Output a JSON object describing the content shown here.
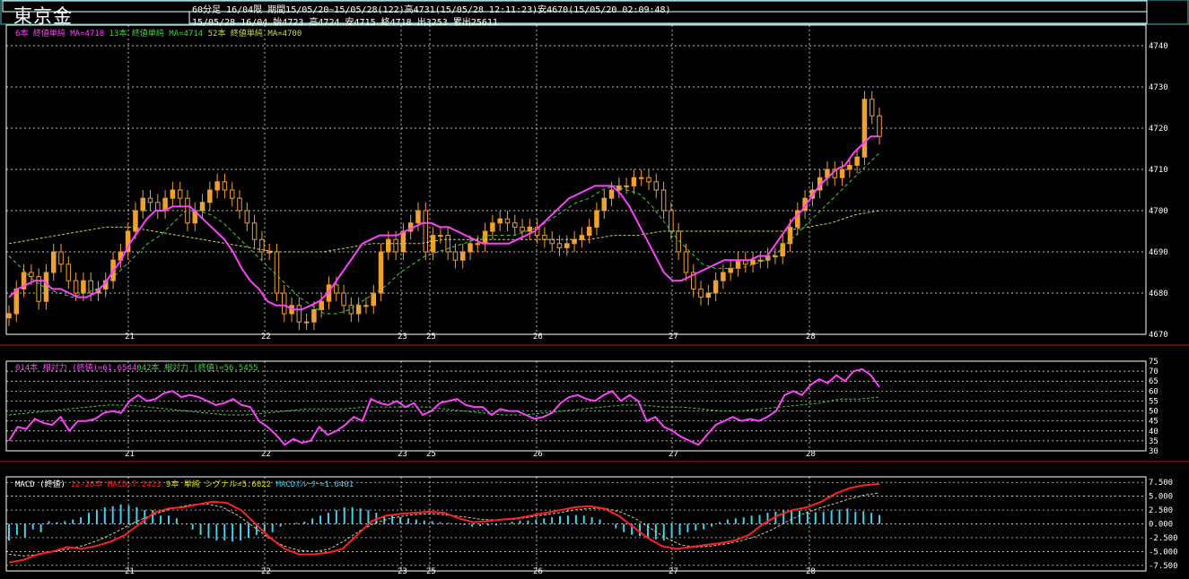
{
  "header": {
    "title": "東京金",
    "line1": "60分足 16/04限 期間15/05/20~15/05/28(122)高4731(15/05/28 12:11:23)安4670(15/05/20 02:09:48)",
    "line2": "15/05/28 16/04 始4723 高4724 安4715 終4718 出3253 累出25611"
  },
  "colors": {
    "ma_short": "#ff40ff",
    "ma_mid": "#40d040",
    "ma_long": "#c8d850",
    "candle_up": "#f0a030",
    "rsi_line": "#ff40ff",
    "macd_line": "#ff2020",
    "signal_line": "#d0d0a0",
    "osc_bar": "#40d0f0",
    "panel_border": "#ffffff",
    "separator": "#c01020"
  },
  "legend": {
    "price": [
      {
        "text": "6本 終値単純 MA=4718",
        "color": "#ff40ff"
      },
      {
        "text": "13本 終値単純 MA=4714",
        "color": "#40d040"
      },
      {
        "text": "52本 終値単純 MA=4700",
        "color": "#c8d850"
      }
    ],
    "rsi": [
      {
        "text": "014本 相対力 (終値)=61.6544",
        "color": "#ff40ff"
      },
      {
        "text": "042本 相対力 (終値)=56.5455",
        "color": "#40d040"
      }
    ],
    "macd": [
      {
        "text": "MACD (終値)",
        "color": "#ffffff"
      },
      {
        "text": "12-26本 MACD=7.2423",
        "color": "#ff2020"
      },
      {
        "text": "9本 単純 シグナル=5.6022",
        "color": "#e0e000"
      },
      {
        "text": "MACDｵｼﾚｰﾀｰ=1.6401",
        "color": "#40d0f0"
      }
    ]
  },
  "chart_data": [
    {
      "type": "candlestick",
      "title": "東京金",
      "xlabel_ticks": [
        "21",
        "22",
        "23",
        "25",
        "26",
        "27",
        "28"
      ],
      "ylim": [
        4670,
        4745
      ],
      "yticks": [
        4670,
        4680,
        4690,
        4700,
        4710,
        4720,
        4730,
        4740
      ],
      "close": [
        4675,
        4681,
        4685,
        4684,
        4678,
        4685,
        4690,
        4687,
        4683,
        4680,
        4683,
        4680,
        4681,
        4683,
        4688,
        4690,
        4695,
        4700,
        4703,
        4702,
        4700,
        4703,
        4705,
        4703,
        4697,
        4700,
        4702,
        4705,
        4707,
        4705,
        4703,
        4700,
        4697,
        4693,
        4690,
        4690,
        4680,
        4675,
        4677,
        4673,
        4673,
        4676,
        4678,
        4682,
        4680,
        4677,
        4675,
        4677,
        4677,
        4680,
        4690,
        4693,
        4690,
        4695,
        4697,
        4700,
        4690,
        4694,
        4694,
        4690,
        4688,
        4690,
        4692,
        4692,
        4695,
        4697,
        4698,
        4697,
        4696,
        4695,
        4696,
        4694,
        4693,
        4692,
        4691,
        4692,
        4693,
        4694,
        4696,
        4700,
        4703,
        4705,
        4706,
        4706,
        4708,
        4708,
        4707,
        4705,
        4700,
        4695,
        4690,
        4685,
        4681,
        4679,
        4680,
        4683,
        4685,
        4686,
        4688,
        4687,
        4688,
        4688,
        4689,
        4689,
        4692,
        4696,
        4700,
        4703,
        4705,
        4708,
        4710,
        4708,
        4710,
        4711,
        4713,
        4727,
        4723,
        4718
      ],
      "ma_6": [
        4679,
        4681,
        4682,
        4683,
        4683,
        4681,
        4681,
        4680,
        4679,
        4679,
        4680,
        4682,
        4685,
        4688,
        4692,
        4695,
        4698,
        4700,
        4700,
        4701,
        4701,
        4701,
        4699,
        4697,
        4695,
        4693,
        4690,
        4686,
        4683,
        4681,
        4678,
        4677,
        4677,
        4676,
        4676,
        4677,
        4678,
        4680,
        4683,
        4686,
        4689,
        4692,
        4693,
        4694,
        4694,
        4694,
        4695,
        4696,
        4697,
        4697,
        4696,
        4696,
        4695,
        4694,
        4693,
        4692,
        4692,
        4692,
        4692,
        4693,
        4694,
        4695,
        4697,
        4699,
        4701,
        4703,
        4704,
        4705,
        4706,
        4706,
        4706,
        4704,
        4701,
        4697,
        4693,
        4689,
        4685,
        4683,
        4683,
        4684,
        4685,
        4686,
        4687,
        4688,
        4688,
        4688,
        4688,
        4689,
        4689,
        4692,
        4695,
        4698,
        4700,
        4703,
        4706,
        4708,
        4710,
        4711,
        4714,
        4716,
        4718,
        4718
      ],
      "ma_13": [
        4689,
        4686,
        4683,
        4681,
        4680,
        4679,
        4680,
        4681,
        4683,
        4686,
        4689,
        4692,
        4694,
        4697,
        4700,
        4700,
        4699,
        4697,
        4694,
        4691,
        4688,
        4685,
        4682,
        4679,
        4677,
        4675,
        4675,
        4676,
        4678,
        4680,
        4682,
        4685,
        4687,
        4689,
        4690,
        4691,
        4692,
        4693,
        4694,
        4694,
        4694,
        4695,
        4696,
        4698,
        4700,
        4702,
        4703,
        4705,
        4706,
        4705,
        4704,
        4701,
        4697,
        4693,
        4690,
        4687,
        4686,
        4686,
        4686,
        4687,
        4688,
        4690,
        4693,
        4696,
        4699,
        4702,
        4705,
        4708,
        4711,
        4714
      ],
      "ma_52": [
        4692,
        4693,
        4694,
        4695,
        4696,
        4696,
        4695,
        4694,
        4693,
        4692,
        4691,
        4690,
        4690,
        4690,
        4691,
        4692,
        4692,
        4692,
        4693,
        4693,
        4693,
        4693,
        4693,
        4693,
        4693,
        4694,
        4694,
        4695,
        4695,
        4695,
        4695,
        4695,
        4695,
        4696,
        4697,
        4699,
        4700
      ]
    },
    {
      "type": "line",
      "title": "RSI",
      "ylim": [
        30,
        75
      ],
      "yticks": [
        30,
        35,
        40,
        45,
        50,
        55,
        60,
        65,
        70,
        75
      ],
      "rsi_14": [
        35,
        42,
        41,
        46,
        44,
        43,
        47,
        40,
        45,
        45,
        46,
        49,
        50,
        49,
        55,
        58,
        55,
        56,
        59,
        60,
        57,
        58,
        57,
        55,
        53,
        54,
        56,
        53,
        52,
        45,
        42,
        38,
        33,
        36,
        34,
        35,
        42,
        38,
        40,
        43,
        47,
        45,
        56,
        54,
        53,
        55,
        52,
        54,
        48,
        50,
        54,
        55,
        56,
        53,
        52,
        52,
        48,
        51,
        50,
        50,
        48,
        46,
        47,
        49,
        54,
        57,
        58,
        56,
        55,
        58,
        60,
        55,
        58,
        55,
        45,
        47,
        42,
        40,
        37,
        35,
        33,
        38,
        43,
        45,
        47,
        45,
        46,
        45,
        47,
        50,
        58,
        60,
        58,
        63,
        66,
        64,
        68,
        65,
        70,
        71,
        68,
        62
      ],
      "rsi_42": [
        48,
        49,
        50,
        51,
        52,
        53,
        53,
        52,
        51,
        50,
        49,
        48,
        48,
        49,
        50,
        51,
        51,
        51,
        52,
        52,
        52,
        52,
        51,
        50,
        49,
        48,
        48,
        49,
        50,
        51,
        52,
        53,
        53,
        52,
        52,
        51,
        50,
        50,
        51,
        52,
        53,
        54,
        56,
        56,
        57
      ]
    },
    {
      "type": "line",
      "title": "MACD (終値)",
      "ylim": [
        -8.5,
        8.5
      ],
      "yticks": [
        7.5,
        5.0,
        2.5,
        0.0,
        -2.5,
        -5.0,
        -7.5
      ],
      "macd": [
        -7,
        -6.5,
        -5.5,
        -5,
        -4.2,
        -4.5,
        -4.0,
        -3.2,
        -2.0,
        0.0,
        2.0,
        2.8,
        3.0,
        3.5,
        4.0,
        3.8,
        2.5,
        0.0,
        -2.5,
        -4.5,
        -5.5,
        -5.5,
        -5.2,
        -4.5,
        -2.0,
        0.5,
        1.5,
        1.8,
        2.0,
        2.2,
        2.0,
        1.0,
        0.3,
        0.5,
        0.8,
        1.0,
        1.5,
        2.0,
        2.5,
        3.0,
        3.2,
        2.8,
        1.5,
        -0.5,
        -2.5,
        -4.0,
        -4.5,
        -4.2,
        -3.8,
        -3.5,
        -3.0,
        -2.0,
        0.0,
        1.5,
        2.5,
        3.0,
        4.0,
        5.5,
        6.5,
        7.0,
        7.2
      ],
      "signal": [
        -5.5,
        -5.8,
        -5.5,
        -5.0,
        -4.5,
        -3.8,
        -2.8,
        -1.5,
        0.0,
        1.2,
        2.2,
        3.0,
        3.5,
        3.6,
        3.0,
        1.5,
        -0.5,
        -2.5,
        -4.0,
        -4.8,
        -5.0,
        -4.5,
        -3.0,
        -1.2,
        0.2,
        1.0,
        1.5,
        1.8,
        1.8,
        1.5,
        1.2,
        0.8,
        0.7,
        0.8,
        1.2,
        1.6,
        2.0,
        2.5,
        2.8,
        2.8,
        2.2,
        1.0,
        -0.8,
        -2.5,
        -3.8,
        -4.2,
        -4.0,
        -3.6,
        -3.0,
        -2.2,
        -1.0,
        0.5,
        1.8,
        2.8,
        3.6,
        4.5,
        5.2,
        5.6
      ],
      "oscillator": [
        -3,
        -2,
        -2.5,
        -1,
        -1.5,
        0.5,
        0.3,
        0.5,
        0.8,
        1.2,
        2,
        2.5,
        3,
        3.2,
        3.5,
        3.3,
        3.0,
        2.5,
        2.5,
        1.5,
        1.5,
        1,
        0,
        -1,
        -2,
        -2.5,
        -3,
        -3,
        -3.2,
        -3,
        -2.5,
        -2,
        -1.5,
        -1.5,
        -0.5,
        0,
        0.2,
        0.4,
        1,
        1.5,
        2,
        2.5,
        3,
        3,
        2.8,
        2.5,
        2,
        1.5,
        1.5,
        1.2,
        1,
        0.8,
        0.6,
        0.5,
        0.3,
        0.2,
        0.1,
        -0.2,
        -0.5,
        -0.4,
        -0.3,
        -0.3,
        0.1,
        0.4,
        0.6,
        0.6,
        0.8,
        1,
        1.2,
        1.4,
        1.5,
        1.6,
        1.5,
        1.2,
        0.8,
        0,
        -0.8,
        -1.5,
        -2,
        -2.2,
        -2.5,
        -2.8,
        -3,
        -2.6,
        -2,
        -1.5,
        -1.2,
        -1,
        -0.5,
        0.3,
        0.8,
        1,
        1.2,
        1.5,
        1.6,
        2,
        2.2,
        2.5,
        2.5,
        2.4,
        2.2,
        2.1,
        2.2,
        2.4,
        2.6,
        2.8,
        2.2,
        2.3,
        2.0,
        1.6
      ]
    }
  ]
}
